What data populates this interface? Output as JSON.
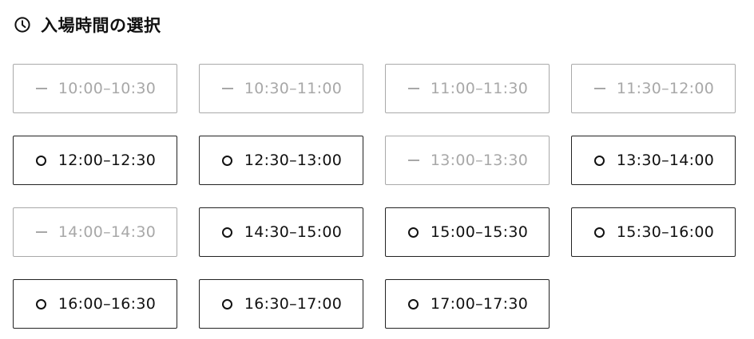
{
  "header": {
    "icon": "clock-icon",
    "title": "入場時間の選択"
  },
  "colors": {
    "available_text": "#111111",
    "unavailable_text": "#a8a8a8",
    "available_border": "#222222",
    "unavailable_border": "#a9a9a9"
  },
  "slots": [
    {
      "label": "10:00–10:30",
      "available": false,
      "mark": "—"
    },
    {
      "label": "10:30–11:00",
      "available": false,
      "mark": "—"
    },
    {
      "label": "11:00–11:30",
      "available": false,
      "mark": "—"
    },
    {
      "label": "11:30–12:00",
      "available": false,
      "mark": "—"
    },
    {
      "label": "12:00–12:30",
      "available": true,
      "mark": "○"
    },
    {
      "label": "12:30–13:00",
      "available": true,
      "mark": "○"
    },
    {
      "label": "13:00–13:30",
      "available": false,
      "mark": "—"
    },
    {
      "label": "13:30–14:00",
      "available": true,
      "mark": "○"
    },
    {
      "label": "14:00–14:30",
      "available": false,
      "mark": "—"
    },
    {
      "label": "14:30–15:00",
      "available": true,
      "mark": "○"
    },
    {
      "label": "15:00–15:30",
      "available": true,
      "mark": "○"
    },
    {
      "label": "15:30–16:00",
      "available": true,
      "mark": "○"
    },
    {
      "label": "16:00–16:30",
      "available": true,
      "mark": "○"
    },
    {
      "label": "16:30–17:00",
      "available": true,
      "mark": "○"
    },
    {
      "label": "17:00–17:30",
      "available": true,
      "mark": "○"
    }
  ]
}
